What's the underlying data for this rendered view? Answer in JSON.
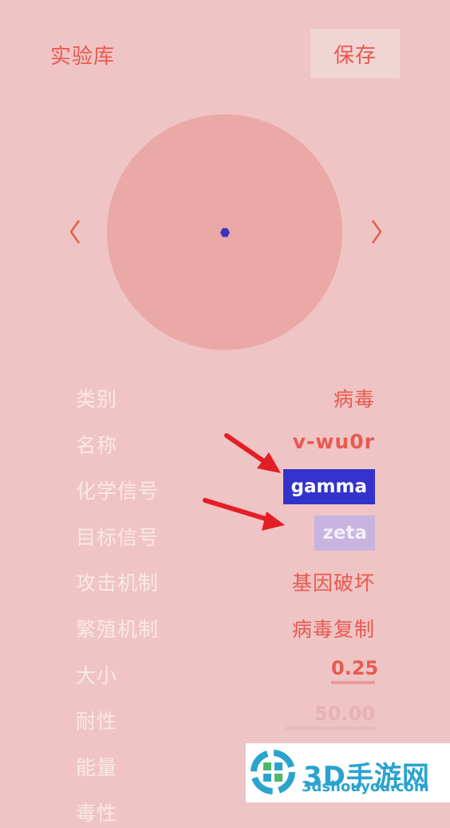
{
  "header": {
    "title": "实验库",
    "save_label": "保存"
  },
  "nav": {
    "prev_icon": "chevron-left-icon",
    "next_icon": "chevron-right-icon"
  },
  "properties": [
    {
      "label": "类别",
      "value": "病毒"
    },
    {
      "label": "名称",
      "value": "v-wu0r"
    },
    {
      "label": "化学信号",
      "value": "gamma"
    },
    {
      "label": "目标信号",
      "value": "zeta"
    },
    {
      "label": "攻击机制",
      "value": "基因破坏"
    },
    {
      "label": "繁殖机制",
      "value": "病毒复制"
    },
    {
      "label": "大小",
      "value": "0.25"
    },
    {
      "label": "耐性",
      "value": "50.00"
    },
    {
      "label": "能量",
      "value": ""
    },
    {
      "label": "毒性",
      "value": ""
    }
  ],
  "watermark": {
    "brand": "3D手游网",
    "url": "3dshouyou.com"
  },
  "colors": {
    "background": "#efc4c4",
    "accent": "#e85a50",
    "circle": "#eaa8a6",
    "gamma_chip": "#3333cc",
    "zeta_chip": "#c7b5df",
    "arrow": "#e41e26"
  }
}
